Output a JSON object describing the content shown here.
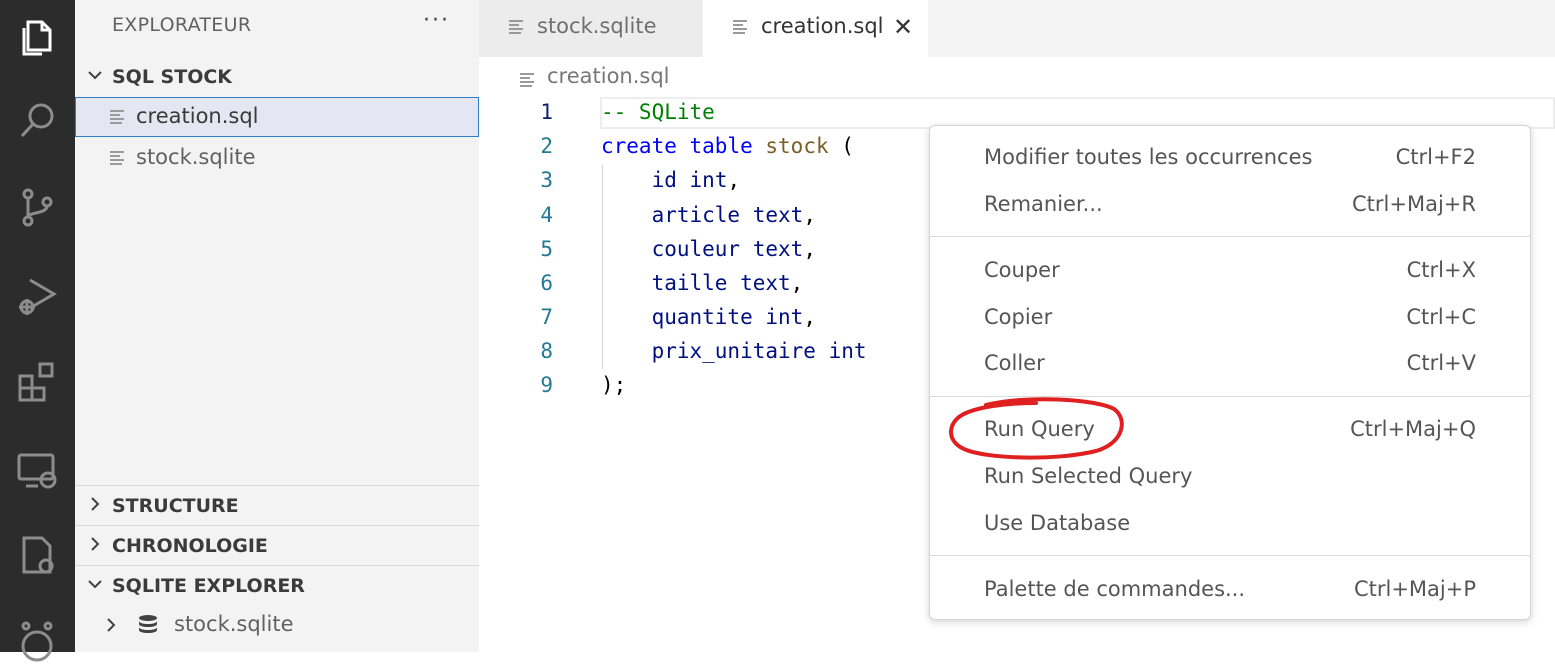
{
  "sidebar": {
    "title": "EXPLORATEUR",
    "more": "···",
    "sections": {
      "sql_stock": "SQL STOCK",
      "structure": "STRUCTURE",
      "chronologie": "CHRONOLOGIE",
      "sqlite_explorer": "SQLITE EXPLORER"
    },
    "files": [
      "creation.sql",
      "stock.sqlite"
    ],
    "sqlite_db": "stock.sqlite"
  },
  "tabs": [
    {
      "label": "stock.sqlite",
      "active": false
    },
    {
      "label": "creation.sql",
      "active": true
    }
  ],
  "tab_close": "✕",
  "breadcrumb": "creation.sql",
  "editor": {
    "line_numbers": [
      "1",
      "2",
      "3",
      "4",
      "5",
      "6",
      "7",
      "8",
      "9"
    ],
    "lines": {
      "l1": "-- SQLite",
      "l2_kw1": "create",
      "l2_kw2": "table",
      "l2_name": "stock",
      "l2_paren": "(",
      "l3_col": "id",
      "l3_type": "int",
      "l4_col": "article",
      "l4_type": "text",
      "l5_col": "couleur",
      "l5_type": "text",
      "l6_col": "taille",
      "l6_type": "text",
      "l7_col": "quantite",
      "l7_type": "int",
      "l8_col": "prix_unitaire",
      "l8_type": "int",
      "l9": ");"
    }
  },
  "context_menu": {
    "items": [
      {
        "label": "Modifier toutes les occurrences",
        "shortcut": "Ctrl+F2"
      },
      {
        "label": "Remanier...",
        "shortcut": "Ctrl+Maj+R"
      },
      {
        "label": "Couper",
        "shortcut": "Ctrl+X"
      },
      {
        "label": "Copier",
        "shortcut": "Ctrl+C"
      },
      {
        "label": "Coller",
        "shortcut": "Ctrl+V"
      },
      {
        "label": "Run Query",
        "shortcut": "Ctrl+Maj+Q"
      },
      {
        "label": "Run Selected Query",
        "shortcut": ""
      },
      {
        "label": "Use Database",
        "shortcut": ""
      },
      {
        "label": "Palette de commandes...",
        "shortcut": "Ctrl+Maj+P"
      }
    ]
  },
  "colors": {
    "activity_bar": "#2c2c2c",
    "sidebar": "#f3f3f3",
    "keyword": "#0000ff",
    "comment": "#008000",
    "annotation": "#e02020"
  },
  "icons": [
    "files-icon",
    "search-icon",
    "source-control-icon",
    "run-debug-icon",
    "extensions-icon",
    "remote-explorer-icon",
    "settings-sync-icon",
    "copilot-icon"
  ]
}
